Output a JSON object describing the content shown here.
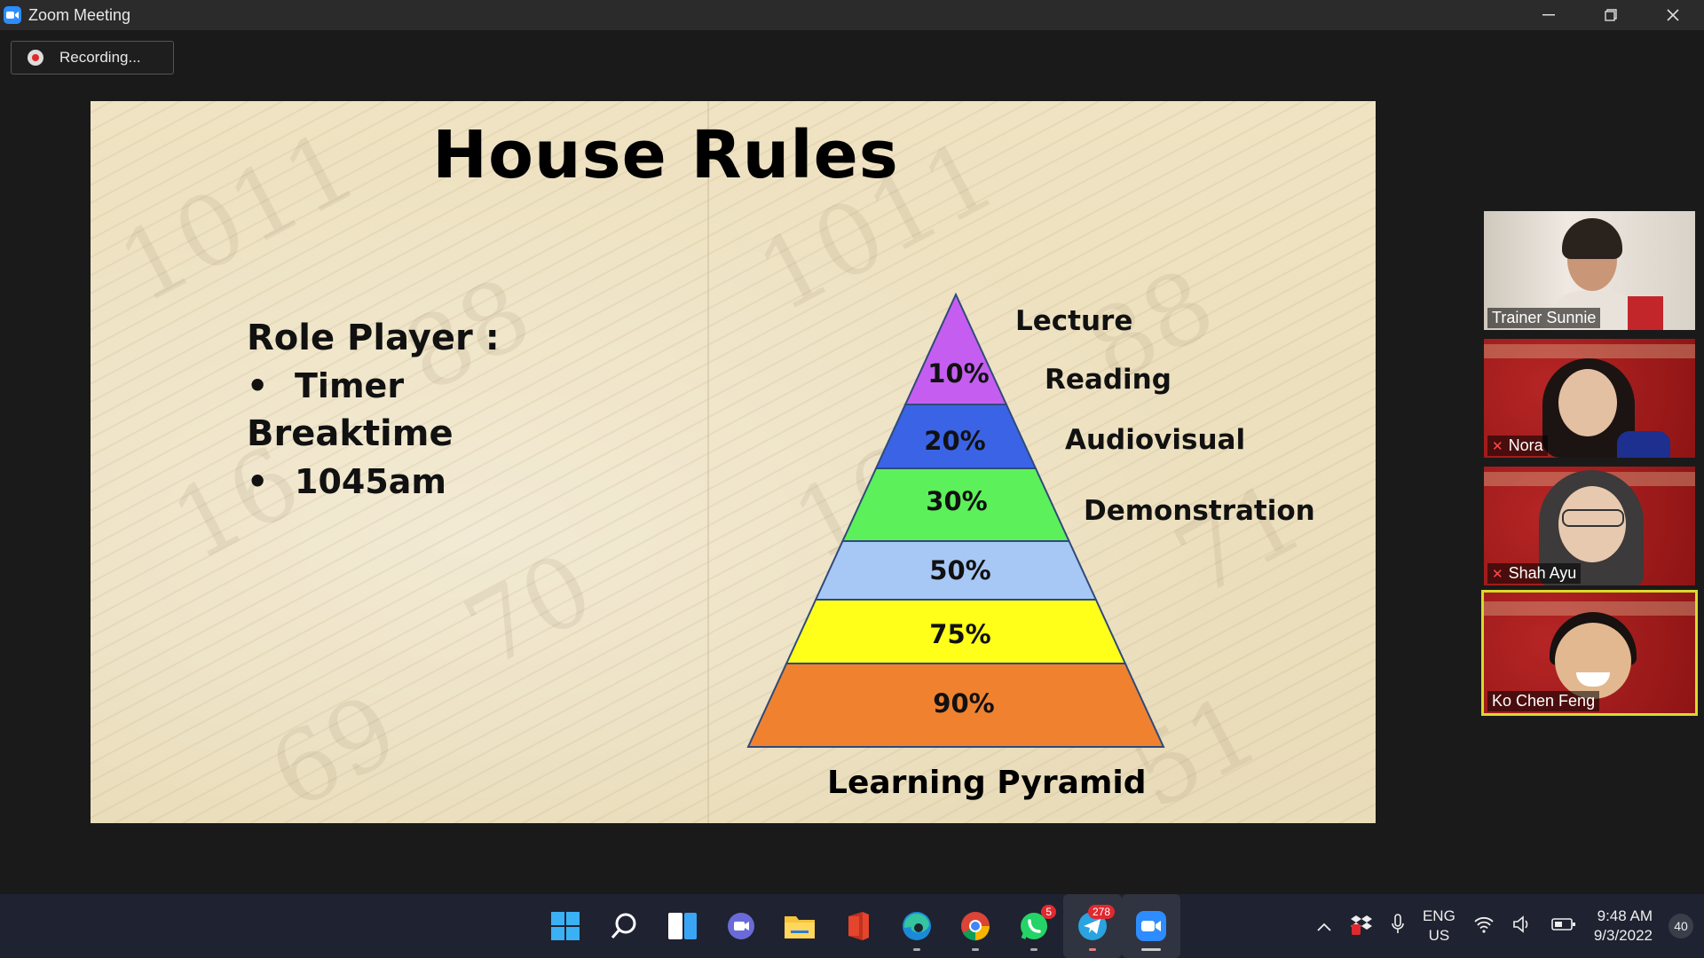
{
  "window": {
    "title": "Zoom Meeting"
  },
  "recording": {
    "label": "Recording..."
  },
  "slide": {
    "title": "House Rules",
    "rules": [
      {
        "type": "heading",
        "text": "Role Player :"
      },
      {
        "type": "bullet",
        "text": "Timer"
      },
      {
        "type": "heading",
        "text": "Breaktime"
      },
      {
        "type": "bullet",
        "text": "1045am"
      }
    ],
    "bullet_symbol": "•",
    "pyramid": {
      "caption": "Learning Pyramid",
      "labels": [
        "Lecture",
        "Reading",
        "Audiovisual",
        "Demonstration"
      ],
      "levels": [
        {
          "pct": "10%",
          "color": "#c55ef0"
        },
        {
          "pct": "20%",
          "color": "#3a63e6"
        },
        {
          "pct": "30%",
          "color": "#5cf05a"
        },
        {
          "pct": "50%",
          "color": "#a7c8f5"
        },
        {
          "pct": "75%",
          "color": "#ffff19"
        },
        {
          "pct": "90%",
          "color": "#f0822f"
        }
      ]
    }
  },
  "participants": [
    {
      "name": "Trainer Sunnie",
      "muted": false,
      "active": false
    },
    {
      "name": "Nora",
      "muted": true,
      "active": false
    },
    {
      "name": "Shah Ayu",
      "muted": true,
      "active": false
    },
    {
      "name": "Ko Chen Feng",
      "muted": false,
      "active": true
    }
  ],
  "taskbar": {
    "whatsapp_badge": "5",
    "telegram_badge": "278",
    "lang_line1": "ENG",
    "lang_line2": "US",
    "time": "9:48 AM",
    "date": "9/3/2022",
    "notifications": "40"
  }
}
